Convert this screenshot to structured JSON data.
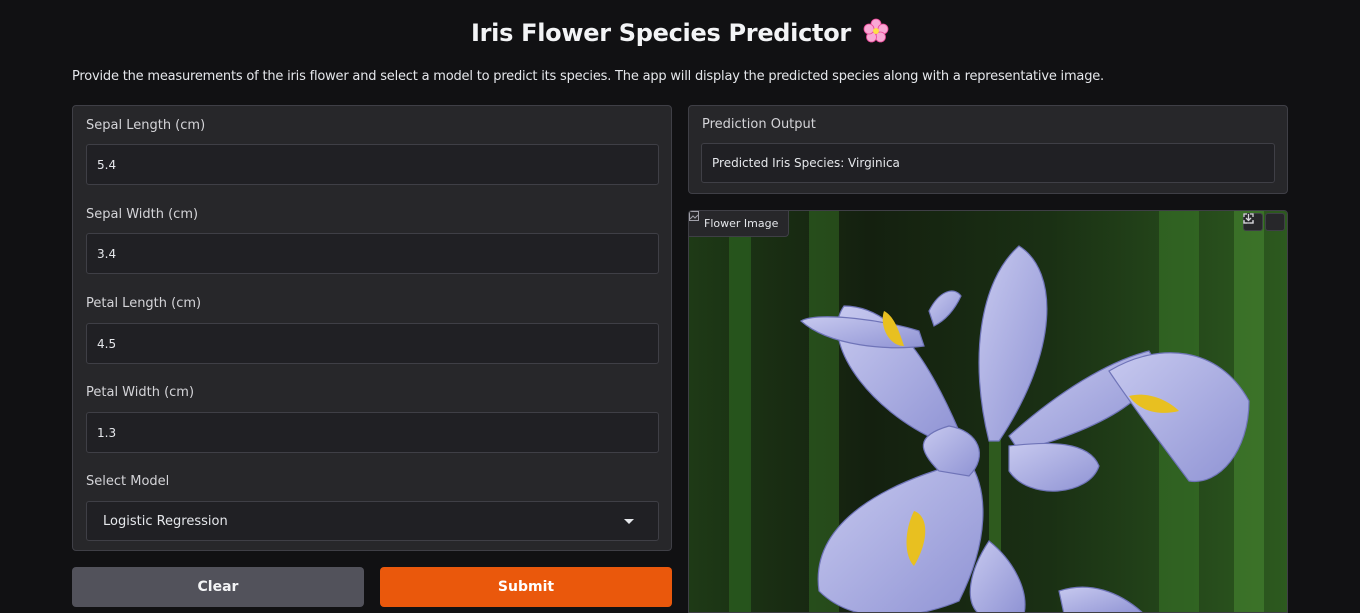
{
  "header": {
    "title": "Iris Flower Species Predictor",
    "title_icon": "cherry-blossom-icon",
    "description": "Provide the measurements of the iris flower and select a model to predict its species. The app will display the predicted species along with a representative image."
  },
  "inputs": {
    "sepal_length": {
      "label": "Sepal Length (cm)",
      "value": "5.4"
    },
    "sepal_width": {
      "label": "Sepal Width (cm)",
      "value": "3.4"
    },
    "petal_length": {
      "label": "Petal Length (cm)",
      "value": "4.5"
    },
    "petal_width": {
      "label": "Petal Width (cm)",
      "value": "1.3"
    },
    "model": {
      "label": "Select Model",
      "value": "Logistic Regression"
    }
  },
  "buttons": {
    "clear_label": "Clear",
    "submit_label": "Submit"
  },
  "output": {
    "label": "Prediction Output",
    "value": "Predicted Iris Species: Virginica"
  },
  "image": {
    "label": "Flower Image",
    "tools": [
      "fullscreen-icon",
      "download-icon"
    ]
  },
  "colors": {
    "background": "#111113",
    "panel": "#27272a",
    "submit_accent": "#ea580c",
    "clear_button": "#52525b"
  }
}
